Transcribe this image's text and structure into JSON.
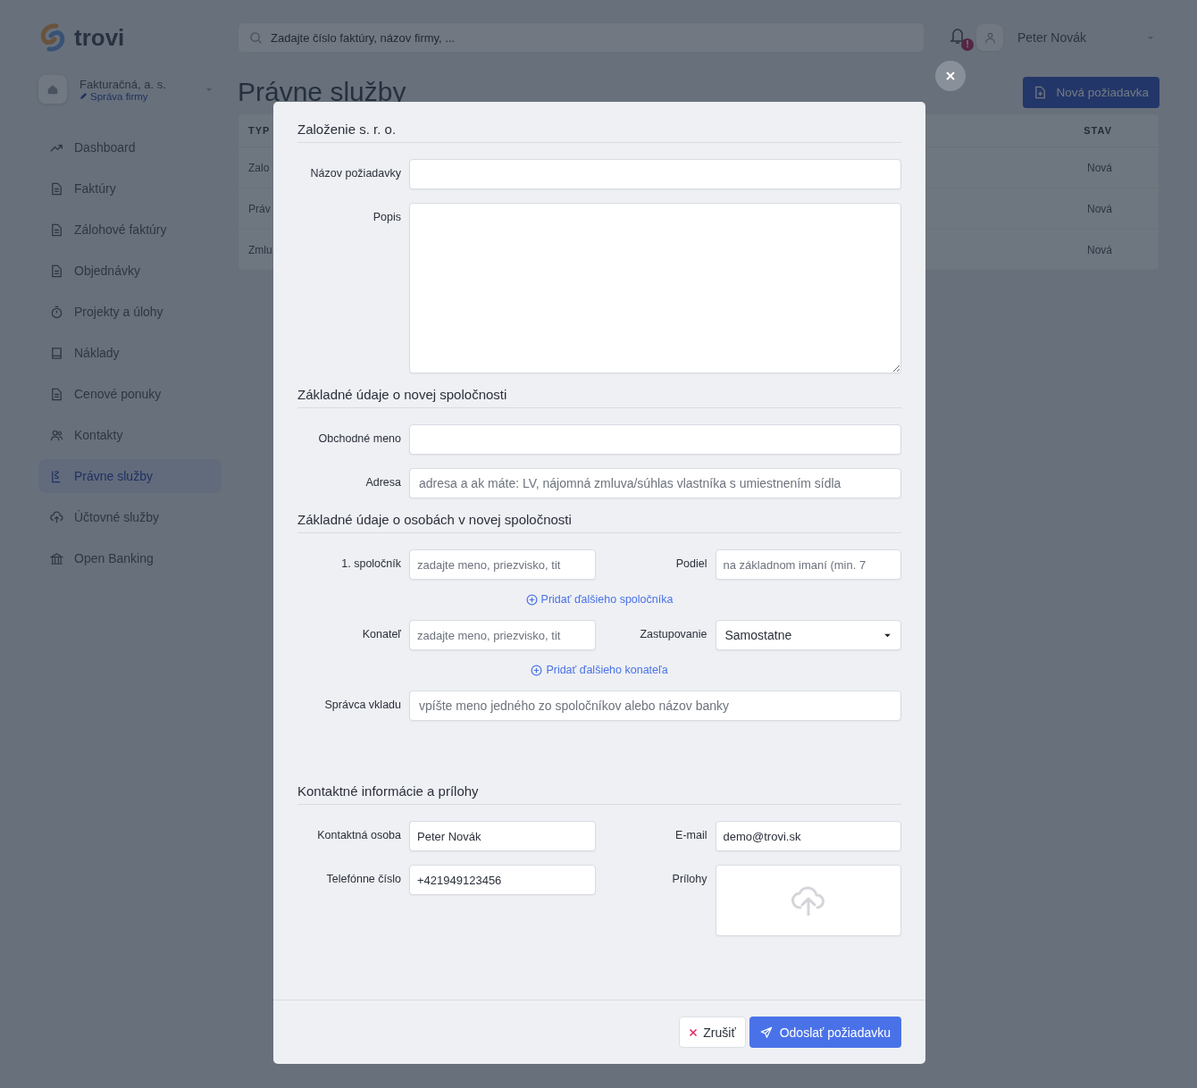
{
  "app": {
    "logo": "trovi",
    "search_placeholder": "Zadajte číslo faktúry, názov firmy, ...",
    "notification_badge": "!",
    "user": "Peter Novák"
  },
  "company": {
    "name": "Fakturačná, a. s.",
    "link": "Správa firmy"
  },
  "sidebar": {
    "items": [
      {
        "label": "Dashboard",
        "selected": false
      },
      {
        "label": "Faktúry",
        "selected": false
      },
      {
        "label": "Zálohové faktúry",
        "selected": false
      },
      {
        "label": "Objednávky",
        "selected": false
      },
      {
        "label": "Projekty a úlohy",
        "selected": false
      },
      {
        "label": "Náklady",
        "selected": false
      },
      {
        "label": "Cenové ponuky",
        "selected": false
      },
      {
        "label": "Kontakty",
        "selected": false
      },
      {
        "label": "Právne služby",
        "selected": true
      },
      {
        "label": "Účtovné služby",
        "selected": false
      },
      {
        "label": "Open Banking",
        "selected": false
      }
    ]
  },
  "page": {
    "title": "Právne služby",
    "new_button": "Nová požiadavka",
    "table": {
      "columns": [
        "TYP",
        "STAV"
      ],
      "rows": [
        [
          "Zalo",
          "Nová"
        ],
        [
          "Práv",
          "Nová"
        ],
        [
          "Zmlu",
          "Nová"
        ]
      ]
    }
  },
  "modal": {
    "sections": [
      {
        "title": "Založenie s. r. o.",
        "rows": [
          {
            "kind": "input",
            "label": "Názov požiadavky"
          },
          {
            "kind": "textarea",
            "label": "Popis"
          }
        ]
      },
      {
        "title": "Základné údaje o novej spoločnosti",
        "rows": [
          {
            "kind": "input",
            "label": "Obchodné meno"
          },
          {
            "kind": "input",
            "label": "Adresa",
            "placeholder": "adresa a ak máte: LV, nájomná zmluva/súhlas vlastníka s umiestnením sídla"
          }
        ]
      },
      {
        "title": "Základné údaje o osobách v novej spoločnosti",
        "rows": [
          {
            "kind": "pair",
            "fields": [
              {
                "kind": "input",
                "label": "1. spoločník",
                "placeholder": "zadajte meno, priezvisko, tit"
              },
              {
                "kind": "input",
                "label": "Podiel",
                "placeholder": "na základnom imaní (min. 7"
              }
            ]
          },
          {
            "kind": "link",
            "label": "Pridať ďalšieho spoločníka"
          },
          {
            "kind": "pair",
            "fields": [
              {
                "kind": "input",
                "label": "Konateľ",
                "placeholder": "zadajte meno, priezvisko, tit"
              },
              {
                "kind": "select",
                "label": "Zastupovanie",
                "value": "Samostatne"
              }
            ]
          },
          {
            "kind": "link",
            "label": "Pridať ďalšieho konateľa"
          },
          {
            "kind": "input",
            "label": "Správca vkladu",
            "placeholder": "vpíšte meno jedného zo spoločníkov alebo názov banky"
          }
        ]
      },
      {
        "title": "Kontaktné informácie a prílohy",
        "rows": [
          {
            "kind": "pair",
            "fields": [
              {
                "kind": "input",
                "label": "Kontaktná osoba",
                "value": "Peter Novák"
              },
              {
                "kind": "input",
                "label": "E-mail",
                "value": "demo@trovi.sk"
              }
            ]
          },
          {
            "kind": "pair",
            "fields": [
              {
                "kind": "input",
                "label": "Telefónne číslo",
                "value": "+421949123456"
              },
              {
                "kind": "upload",
                "label": "Prílohy"
              }
            ]
          }
        ]
      }
    ],
    "cancel": "Zrušiť",
    "submit": "Odoslať požiadavku"
  }
}
